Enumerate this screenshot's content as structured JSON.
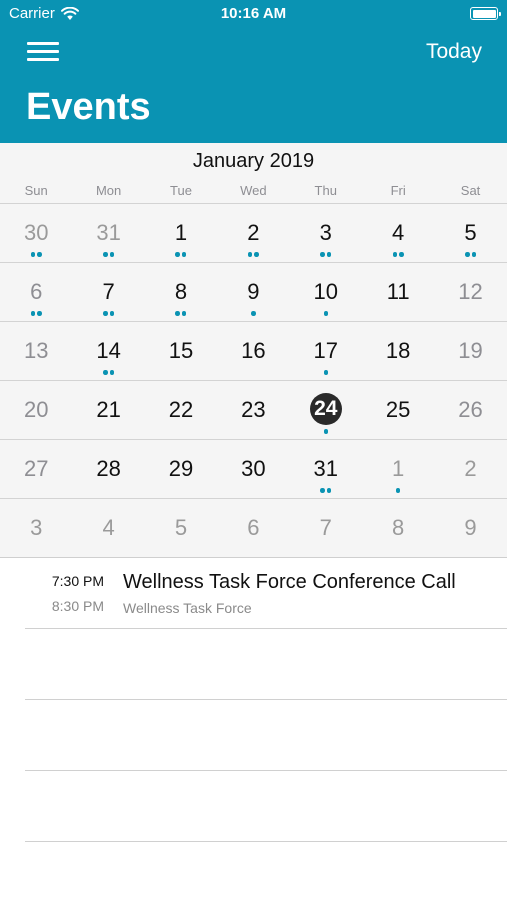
{
  "status_bar": {
    "carrier": "Carrier",
    "time": "10:16 AM"
  },
  "header": {
    "title": "Events",
    "today_label": "Today",
    "menu_icon": "hamburger-menu-icon",
    "background_color": "#0a93b3"
  },
  "calendar": {
    "month_title": "January 2019",
    "weekdays": [
      "Sun",
      "Mon",
      "Tue",
      "Wed",
      "Thu",
      "Fri",
      "Sat"
    ],
    "selected_day": "24",
    "dot_color": "#0a93b3",
    "weeks": [
      [
        {
          "day": "30",
          "other": true,
          "dots": 2
        },
        {
          "day": "31",
          "other": true,
          "dots": 2
        },
        {
          "day": "1",
          "dots": 2
        },
        {
          "day": "2",
          "dots": 2
        },
        {
          "day": "3",
          "dots": 2
        },
        {
          "day": "4",
          "dots": 2
        },
        {
          "day": "5",
          "dots": 2
        }
      ],
      [
        {
          "day": "6",
          "weekend": true,
          "dots": 2
        },
        {
          "day": "7",
          "dots": 2
        },
        {
          "day": "8",
          "dots": 2
        },
        {
          "day": "9",
          "dots": 1
        },
        {
          "day": "10",
          "dots": 1
        },
        {
          "day": "11",
          "dots": 0
        },
        {
          "day": "12",
          "weekend": true,
          "dots": 0
        }
      ],
      [
        {
          "day": "13",
          "weekend": true,
          "dots": 0
        },
        {
          "day": "14",
          "dots": 2
        },
        {
          "day": "15",
          "dots": 0
        },
        {
          "day": "16",
          "dots": 0
        },
        {
          "day": "17",
          "dots": 1
        },
        {
          "day": "18",
          "dots": 0
        },
        {
          "day": "19",
          "weekend": true,
          "dots": 0
        }
      ],
      [
        {
          "day": "20",
          "weekend": true,
          "dots": 0
        },
        {
          "day": "21",
          "dots": 0
        },
        {
          "day": "22",
          "dots": 0
        },
        {
          "day": "23",
          "dots": 0
        },
        {
          "day": "24",
          "selected": true,
          "dots": 1
        },
        {
          "day": "25",
          "dots": 0
        },
        {
          "day": "26",
          "weekend": true,
          "dots": 0
        }
      ],
      [
        {
          "day": "27",
          "weekend": true,
          "dots": 0
        },
        {
          "day": "28",
          "dots": 0
        },
        {
          "day": "29",
          "dots": 0
        },
        {
          "day": "30",
          "dots": 0
        },
        {
          "day": "31",
          "dots": 2
        },
        {
          "day": "1",
          "other": true,
          "dots": 1
        },
        {
          "day": "2",
          "other": true,
          "dots": 0
        }
      ],
      [
        {
          "day": "3",
          "other": true,
          "dots": 0
        },
        {
          "day": "4",
          "other": true,
          "dots": 0
        },
        {
          "day": "5",
          "other": true,
          "dots": 0
        },
        {
          "day": "6",
          "other": true,
          "dots": 0
        },
        {
          "day": "7",
          "other": true,
          "dots": 0
        },
        {
          "day": "8",
          "other": true,
          "dots": 0
        },
        {
          "day": "9",
          "other": true,
          "dots": 0
        }
      ]
    ]
  },
  "events": [
    {
      "start": "7:30 PM",
      "end": "8:30 PM",
      "title": "Wellness Task Force Conference Call",
      "subtitle": "Wellness Task Force"
    }
  ]
}
